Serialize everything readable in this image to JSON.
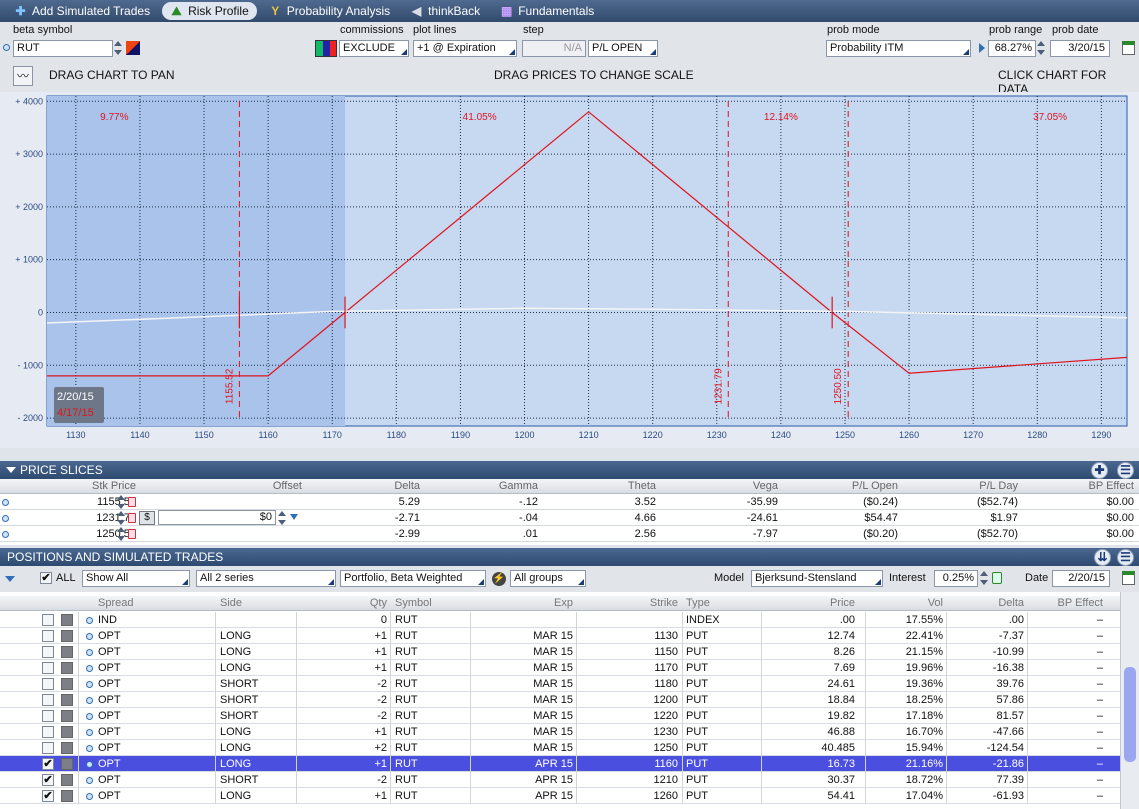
{
  "toolbar": {
    "items": [
      {
        "label": "Add Simulated Trades",
        "icon": "plus-icon"
      },
      {
        "label": "Risk Profile",
        "icon": "risk-profile-icon"
      },
      {
        "label": "Probability Analysis",
        "icon": "probability-icon"
      },
      {
        "label": "thinkBack",
        "icon": "thinkback-icon"
      },
      {
        "label": "Fundamentals",
        "icon": "fundamentals-icon"
      }
    ]
  },
  "controls": {
    "beta_symbol_label": "beta symbol",
    "beta_symbol": "RUT",
    "commissions_label": "commissions",
    "commissions": "EXCLUDE",
    "plot_lines_label": "plot lines",
    "plot_lines": "+1 @ Expiration",
    "step_label": "step",
    "step": "N/A",
    "pl_open": "P/L OPEN",
    "prob_mode_label": "prob mode",
    "prob_mode": "Probability ITM",
    "prob_range_label": "prob range",
    "prob_range": "68.27%",
    "prob_date_label": "prob date",
    "prob_date": "3/20/15"
  },
  "hints": {
    "pan": "DRAG CHART TO PAN",
    "scale": "DRAG PRICES TO CHANGE SCALE",
    "data": "CLICK CHART FOR DATA"
  },
  "chart_data": {
    "type": "line",
    "x_ticks": [
      "1130",
      "1140",
      "1150",
      "1160",
      "1170",
      "1180",
      "1190",
      "1200",
      "1210",
      "1220",
      "1230",
      "1240",
      "1250",
      "1260",
      "1270",
      "1280",
      "1290"
    ],
    "y_ticks": [
      "+ 4000",
      "+ 3000",
      "+ 2000",
      "+ 1000",
      "0",
      "- 1000",
      "- 2000"
    ],
    "xlim": [
      1125.5,
      1294
    ],
    "ylim": [
      -2150,
      4100
    ],
    "series": [
      {
        "color": "#e0141e",
        "x": [
          1125.5,
          1160,
          1172,
          1210,
          1248,
          1260,
          1294
        ],
        "y": [
          -1200,
          -1200,
          0,
          3800,
          0,
          -1150,
          -850
        ]
      },
      {
        "color": "#f4f4f4",
        "x": [
          1125.5,
          1150,
          1170,
          1200,
          1220,
          1250,
          1294
        ],
        "y": [
          -200,
          -80,
          20,
          80,
          60,
          20,
          -100
        ]
      }
    ],
    "prob_labels": [
      {
        "text": "9.77%",
        "x": 1136
      },
      {
        "text": "41.05%",
        "x": 1193
      },
      {
        "text": "12.14%",
        "x": 1240
      },
      {
        "text": "37.05%",
        "x": 1282
      }
    ],
    "markers": [
      {
        "x": 1155.52,
        "label": "1155.52"
      },
      {
        "x": 1231.79,
        "label": "1231.79"
      },
      {
        "x": 1250.5,
        "label": "1250.50"
      }
    ],
    "shade_to": 1172,
    "date_box": {
      "current": "2/20/15",
      "future": "4/17/15"
    }
  },
  "slices": {
    "title": "PRICE SLICES",
    "headers": [
      "Stk Price",
      "Offset",
      "Delta",
      "Gamma",
      "Theta",
      "Vega",
      "P/L Open",
      "P/L Day",
      "BP Effect"
    ],
    "rows": [
      [
        "1155.52",
        "",
        "5.29",
        "-.12",
        "3.52",
        "-35.99",
        "($0.24)",
        "($52.74)",
        "$0.00"
      ],
      [
        "1231.79",
        "$0",
        "-2.71",
        "-.04",
        "4.66",
        "-24.61",
        "$54.47",
        "$1.97",
        "$0.00"
      ],
      [
        "1250.50",
        "",
        "-2.99",
        ".01",
        "2.56",
        "-7.97",
        "($0.20)",
        "($52.70)",
        "$0.00"
      ]
    ]
  },
  "positions": {
    "title": "POSITIONS AND SIMULATED TRADES",
    "all": "ALL",
    "show": "Show All",
    "series": "All 2 series",
    "portfolio": "Portfolio, Beta Weighted",
    "groups": "All groups",
    "model_label": "Model",
    "model": "Bjerksund-Stensland",
    "interest_label": "Interest",
    "interest": "0.25%",
    "date_label": "Date",
    "date": "2/20/15",
    "headers": [
      "Spread",
      "Side",
      "Qty",
      "Symbol",
      "Exp",
      "Strike",
      "Type",
      "Price",
      "Vol",
      "Delta",
      "BP Effect"
    ],
    "rows": [
      {
        "c": [
          "IND",
          "",
          "0",
          "RUT",
          "",
          "",
          "INDEX",
          ".00",
          "17.55%",
          ".00",
          "–"
        ],
        "chk": false,
        "sel": false
      },
      {
        "c": [
          "OPT",
          "LONG",
          "+1",
          "RUT",
          "MAR 15",
          "1130",
          "PUT",
          "12.74",
          "22.41%",
          "-7.37",
          "–"
        ],
        "chk": false,
        "sel": false
      },
      {
        "c": [
          "OPT",
          "LONG",
          "+1",
          "RUT",
          "MAR 15",
          "1150",
          "PUT",
          "8.26",
          "21.15%",
          "-10.99",
          "–"
        ],
        "chk": false,
        "sel": false
      },
      {
        "c": [
          "OPT",
          "LONG",
          "+1",
          "RUT",
          "MAR 15",
          "1170",
          "PUT",
          "7.69",
          "19.96%",
          "-16.38",
          "–"
        ],
        "chk": false,
        "sel": false
      },
      {
        "c": [
          "OPT",
          "SHORT",
          "-2",
          "RUT",
          "MAR 15",
          "1180",
          "PUT",
          "24.61",
          "19.36%",
          "39.76",
          "–"
        ],
        "chk": false,
        "sel": false
      },
      {
        "c": [
          "OPT",
          "SHORT",
          "-2",
          "RUT",
          "MAR 15",
          "1200",
          "PUT",
          "18.84",
          "18.25%",
          "57.86",
          "–"
        ],
        "chk": false,
        "sel": false
      },
      {
        "c": [
          "OPT",
          "SHORT",
          "-2",
          "RUT",
          "MAR 15",
          "1220",
          "PUT",
          "19.82",
          "17.18%",
          "81.57",
          "–"
        ],
        "chk": false,
        "sel": false
      },
      {
        "c": [
          "OPT",
          "LONG",
          "+1",
          "RUT",
          "MAR 15",
          "1230",
          "PUT",
          "46.88",
          "16.70%",
          "-47.66",
          "–"
        ],
        "chk": false,
        "sel": false
      },
      {
        "c": [
          "OPT",
          "LONG",
          "+2",
          "RUT",
          "MAR 15",
          "1250",
          "PUT",
          "40.485",
          "15.94%",
          "-124.54",
          "–"
        ],
        "chk": false,
        "sel": false
      },
      {
        "c": [
          "OPT",
          "LONG",
          "+1",
          "RUT",
          "APR 15",
          "1160",
          "PUT",
          "16.73",
          "21.16%",
          "-21.86",
          "–"
        ],
        "chk": true,
        "sel": true
      },
      {
        "c": [
          "OPT",
          "SHORT",
          "-2",
          "RUT",
          "APR 15",
          "1210",
          "PUT",
          "30.37",
          "18.72%",
          "77.39",
          "–"
        ],
        "chk": true,
        "sel": false
      },
      {
        "c": [
          "OPT",
          "LONG",
          "+1",
          "RUT",
          "APR 15",
          "1260",
          "PUT",
          "54.41",
          "17.04%",
          "-61.93",
          "–"
        ],
        "chk": true,
        "sel": false
      }
    ]
  }
}
